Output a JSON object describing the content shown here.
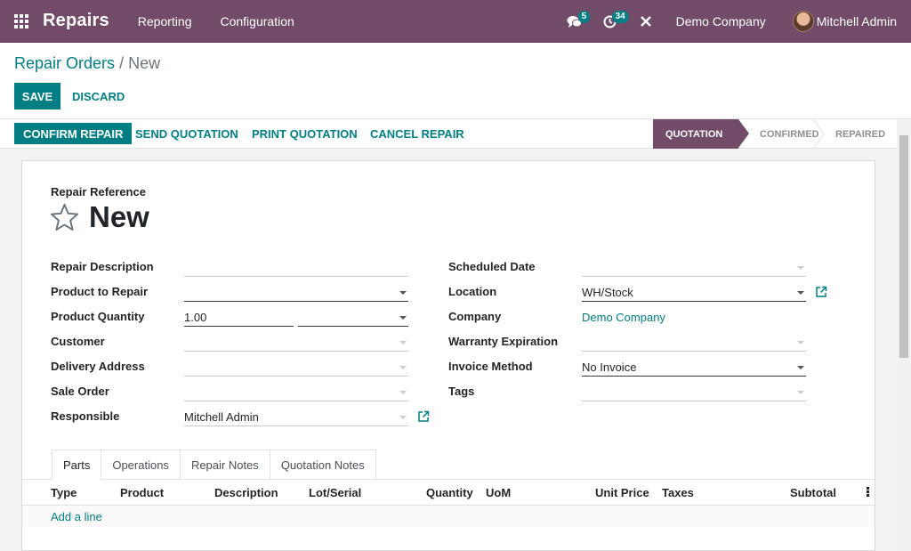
{
  "navbar": {
    "app_name": "Repairs",
    "menus": [
      "Reporting",
      "Configuration"
    ],
    "messages_count": "5",
    "activities_count": "34",
    "company": "Demo Company",
    "user": "Mitchell Admin"
  },
  "breadcrumb": {
    "parent": "Repair Orders",
    "separator": "/",
    "current": "New"
  },
  "buttons": {
    "save": "SAVE",
    "discard": "DISCARD"
  },
  "statusbar": {
    "actions": [
      "CONFIRM REPAIR",
      "SEND QUOTATION",
      "PRINT QUOTATION",
      "CANCEL REPAIR"
    ],
    "stages": [
      "QUOTATION",
      "CONFIRMED",
      "REPAIRED"
    ],
    "current_stage": "QUOTATION"
  },
  "form": {
    "reference_label": "Repair Reference",
    "title": "New",
    "left_fields": {
      "repair_description": {
        "label": "Repair Description",
        "value": ""
      },
      "product_to_repair": {
        "label": "Product to Repair",
        "value": ""
      },
      "product_quantity": {
        "label": "Product Quantity",
        "value": "1.00",
        "uom": ""
      },
      "customer": {
        "label": "Customer",
        "value": ""
      },
      "delivery_address": {
        "label": "Delivery Address",
        "value": ""
      },
      "sale_order": {
        "label": "Sale Order",
        "value": ""
      },
      "responsible": {
        "label": "Responsible",
        "value": "Mitchell Admin"
      }
    },
    "right_fields": {
      "scheduled_date": {
        "label": "Scheduled Date",
        "value": ""
      },
      "location": {
        "label": "Location",
        "value": "WH/Stock"
      },
      "company": {
        "label": "Company",
        "value": "Demo Company"
      },
      "warranty_expiration": {
        "label": "Warranty Expiration",
        "value": ""
      },
      "invoice_method": {
        "label": "Invoice Method",
        "value": "No Invoice"
      },
      "tags": {
        "label": "Tags",
        "value": ""
      }
    }
  },
  "tabs": [
    "Parts",
    "Operations",
    "Repair Notes",
    "Quotation Notes"
  ],
  "parts_table": {
    "columns": [
      "Type",
      "Product",
      "Description",
      "Lot/Serial",
      "Quantity",
      "UoM",
      "Unit Price",
      "Taxes",
      "Subtotal"
    ],
    "add_line": "Add a line"
  },
  "colors": {
    "brand": "#714b67",
    "accent": "#017e84"
  }
}
